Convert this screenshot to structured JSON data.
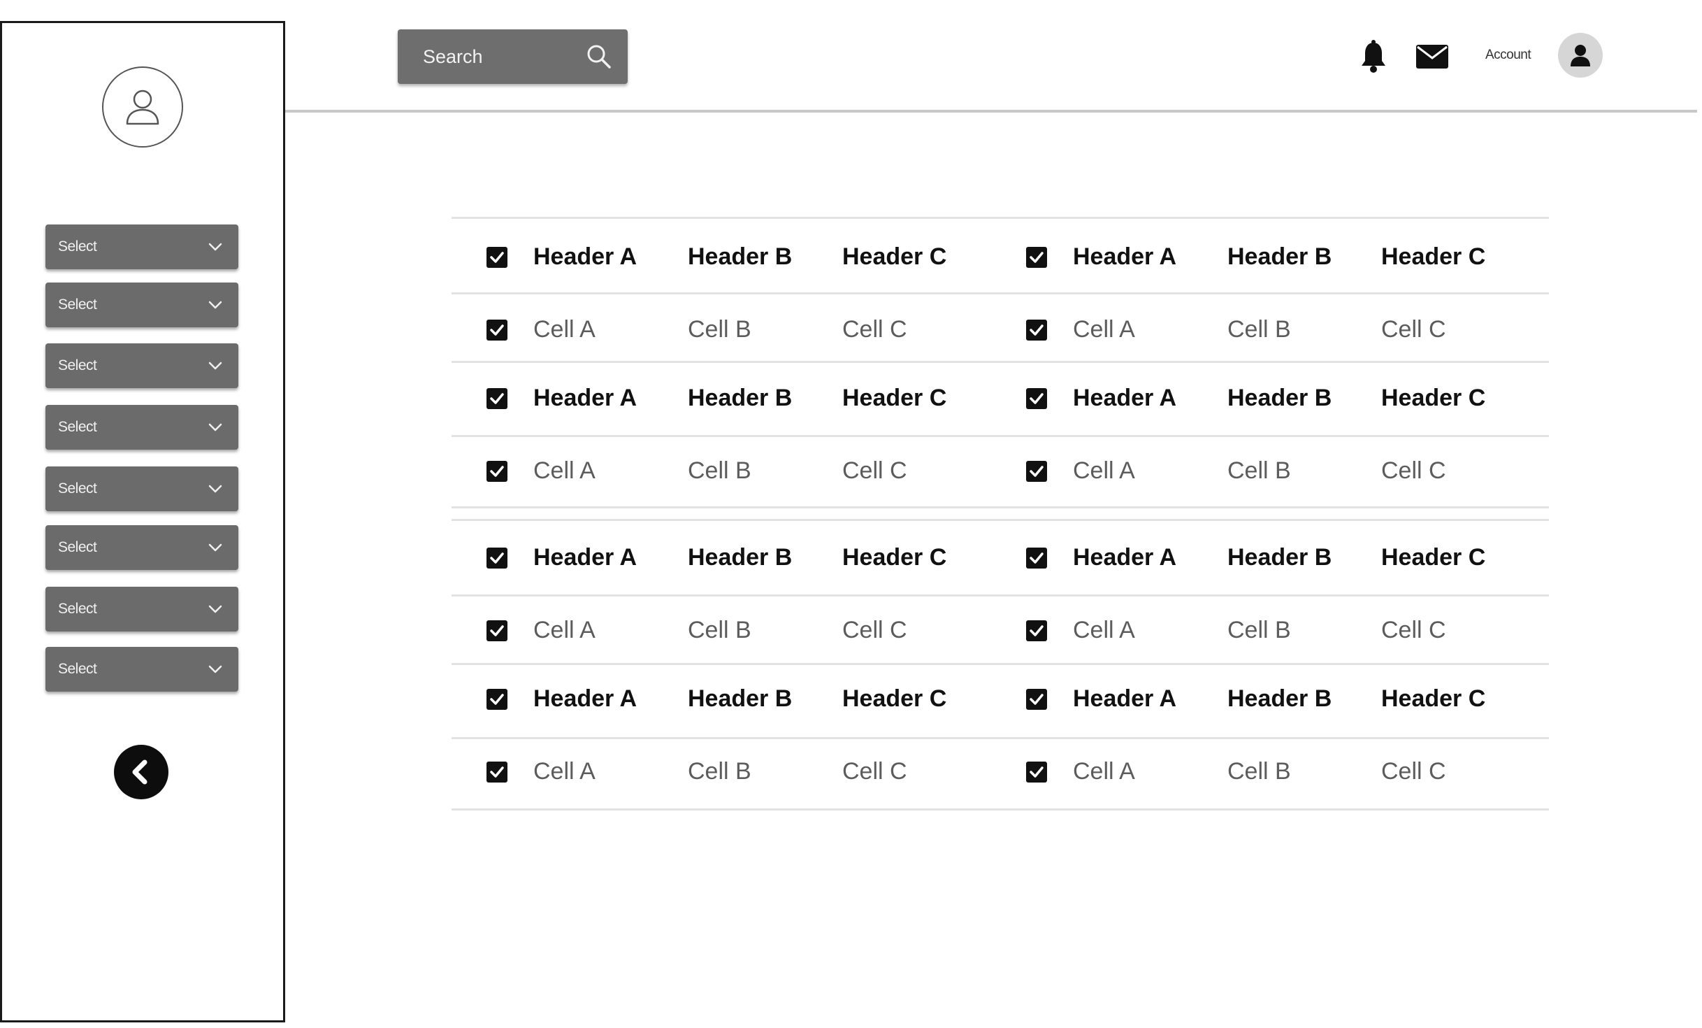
{
  "sidebar": {
    "selects": [
      {
        "label": "Select"
      },
      {
        "label": "Select"
      },
      {
        "label": "Select"
      },
      {
        "label": "Select"
      },
      {
        "label": "Select"
      },
      {
        "label": "Select"
      },
      {
        "label": "Select"
      },
      {
        "label": "Select"
      }
    ]
  },
  "header": {
    "search_placeholder": "Search",
    "account_label": "Account"
  },
  "table": {
    "rows": [
      {
        "type": "header",
        "cells": [
          "Header A",
          "Header B",
          "Header C",
          "Header A",
          "Header B",
          "Header C"
        ]
      },
      {
        "type": "cell",
        "cells": [
          "Cell A",
          "Cell B",
          "Cell C",
          "Cell A",
          "Cell B",
          "Cell C"
        ]
      },
      {
        "type": "header",
        "cells": [
          "Header A",
          "Header B",
          "Header C",
          "Header A",
          "Header B",
          "Header C"
        ]
      },
      {
        "type": "cell",
        "cells": [
          "Cell A",
          "Cell B",
          "Cell C",
          "Cell A",
          "Cell B",
          "Cell C"
        ]
      },
      {
        "type": "header",
        "cells": [
          "Header A",
          "Header B",
          "Header C",
          "Header A",
          "Header B",
          "Header C"
        ]
      },
      {
        "type": "cell",
        "cells": [
          "Cell A",
          "Cell B",
          "Cell C",
          "Cell A",
          "Cell B",
          "Cell C"
        ]
      },
      {
        "type": "header",
        "cells": [
          "Header A",
          "Header B",
          "Header C",
          "Header A",
          "Header B",
          "Header C"
        ]
      },
      {
        "type": "cell",
        "cells": [
          "Cell A",
          "Cell B",
          "Cell C",
          "Cell A",
          "Cell B",
          "Cell C"
        ]
      }
    ]
  },
  "icons": {
    "bell": "bell-icon",
    "mail": "envelope-icon",
    "search": "search-icon",
    "back": "chevron-left-icon"
  },
  "colors": {
    "control_bg": "#6b6b6b",
    "checkbox": "#111111",
    "header_text": "#111111",
    "cell_text": "#5c5c5c"
  }
}
